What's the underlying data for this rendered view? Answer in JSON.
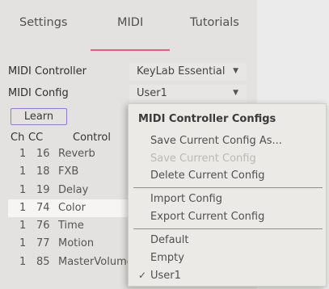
{
  "tabs": [
    "Settings",
    "MIDI",
    "Tutorials"
  ],
  "active_tab_index": 1,
  "midi_controller": {
    "label": "MIDI Controller",
    "value": "KeyLab Essential"
  },
  "midi_config": {
    "label": "MIDI Config",
    "value": "User1"
  },
  "learn_label": "Learn",
  "table": {
    "headers": {
      "ch": "Ch",
      "cc": "CC",
      "control": "Control"
    },
    "rows": [
      {
        "ch": "1",
        "cc": "16",
        "control": "Reverb"
      },
      {
        "ch": "1",
        "cc": "18",
        "control": "FXB"
      },
      {
        "ch": "1",
        "cc": "19",
        "control": "Delay"
      },
      {
        "ch": "1",
        "cc": "74",
        "control": "Color"
      },
      {
        "ch": "1",
        "cc": "76",
        "control": "Time"
      },
      {
        "ch": "1",
        "cc": "77",
        "control": "Motion"
      },
      {
        "ch": "1",
        "cc": "85",
        "control": "MasterVolume"
      }
    ],
    "highlighted_row": 3
  },
  "menu": {
    "title": "MIDI Controller Configs",
    "items": [
      {
        "label": "Save Current Config As...",
        "enabled": true
      },
      {
        "label": "Save Current Config",
        "enabled": false
      },
      {
        "label": "Delete Current Config",
        "enabled": true
      },
      {
        "label": "Import Config",
        "enabled": true
      },
      {
        "label": "Export Current Config",
        "enabled": true
      },
      {
        "label": "Default",
        "enabled": true
      },
      {
        "label": "Empty",
        "enabled": true
      },
      {
        "label": "User1",
        "enabled": true,
        "checked": true
      }
    ],
    "check_glyph": "✓"
  },
  "colors": {
    "accent_underline": "#f05a7e",
    "learn_border": "#8d7ccf",
    "highlight_row": "#f6f5f4"
  },
  "icons": {
    "dropdown": "chevron-down-icon",
    "check": "checkmark-icon"
  }
}
